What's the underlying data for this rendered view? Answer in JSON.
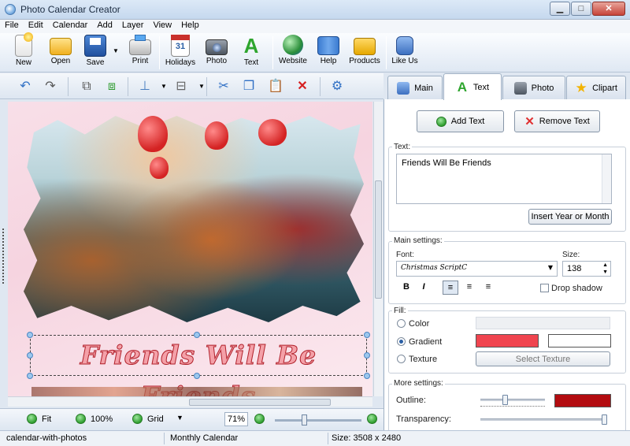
{
  "window": {
    "title": "Photo Calendar Creator",
    "minimize": "▁",
    "maximize": "□",
    "close": "✕"
  },
  "menu": [
    "File",
    "Edit",
    "Calendar",
    "Add",
    "Layer",
    "View",
    "Help"
  ],
  "toolbar": {
    "new": "New",
    "open": "Open",
    "save": "Save",
    "print": "Print",
    "holidays": "Holidays",
    "holidays_num": "31",
    "photo": "Photo",
    "text": "Text",
    "website": "Website",
    "help": "Help",
    "products": "Products",
    "like": "Like Us"
  },
  "canvas": {
    "headline": "Friends Will Be Friends"
  },
  "viewbar": {
    "fit": "Fit",
    "hundred": "100%",
    "grid": "Grid",
    "zoom": "71%"
  },
  "status": {
    "file": "calendar-with-photos",
    "type": "Monthly Calendar",
    "size": "Size: 3508 x 2480"
  },
  "tabs": {
    "main": "Main",
    "text": "Text",
    "photo": "Photo",
    "clipart": "Clipart"
  },
  "panel": {
    "add_text": "Add Text",
    "remove_text": "Remove Text",
    "text_label": "Text:",
    "text_value": "Friends Will Be Friends",
    "insert_year": "Insert Year or Month",
    "main_settings": "Main settings:",
    "font_label": "Font:",
    "font_value": "Christmas ScriptC",
    "size_label": "Size:",
    "size_value": "138",
    "bold": "B",
    "italic": "I",
    "drop_shadow": "Drop shadow",
    "fill_label": "Fill:",
    "color": "Color",
    "gradient": "Gradient",
    "texture": "Texture",
    "select_texture": "Select Texture",
    "more_settings": "More settings:",
    "outline": "Outline:",
    "transparency": "Transparency:",
    "gradient_color_1": "#f0454f",
    "gradient_color_2": "#ffffff",
    "outline_color": "#b30c10"
  }
}
